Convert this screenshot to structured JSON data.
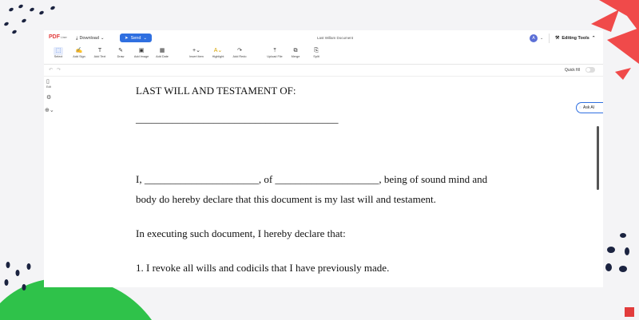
{
  "topbar": {
    "logo_main": "PDF",
    "logo_sub": "Liner",
    "download_label": "Download",
    "send_label": "Send",
    "document_title": "Last Willam Document",
    "avatar_initial": "A",
    "editing_tools_label": "Editing Tools"
  },
  "toolbar": {
    "items": [
      {
        "label": "Select",
        "icon": "select-icon"
      },
      {
        "label": "Add Sign",
        "icon": "sign-icon"
      },
      {
        "label": "Add Text",
        "icon": "text-icon"
      },
      {
        "label": "Draw",
        "icon": "draw-icon"
      },
      {
        "label": "Add Image",
        "icon": "image-icon"
      },
      {
        "label": "Add Date",
        "icon": "calendar-icon"
      },
      {
        "label": "Insert item",
        "icon": "plus-icon"
      },
      {
        "label": "Highlight",
        "icon": "highlight-icon"
      },
      {
        "label": "Add Redo",
        "icon": "redo-icon"
      },
      {
        "label": "Upload File",
        "icon": "upload-icon"
      },
      {
        "label": "Merge",
        "icon": "merge-icon"
      },
      {
        "label": "Split",
        "icon": "split-icon"
      }
    ]
  },
  "subbar": {
    "quick_fill_label": "Quick fill"
  },
  "sidebar": {
    "edit_label": "Edit"
  },
  "ask_ai_label": "Ask AI",
  "document": {
    "heading": "LAST WILL AND TESTAMENT OF:",
    "name_line": "_______________________________________",
    "para1_line1": "I, ______________________, of ____________________, being of sound mind and",
    "para1_line2": "body do hereby declare that this document is my last will and testament.",
    "para2": "In executing such document, I hereby declare that:",
    "item1": "1.  I revoke all wills and codicils that I have previously made."
  }
}
